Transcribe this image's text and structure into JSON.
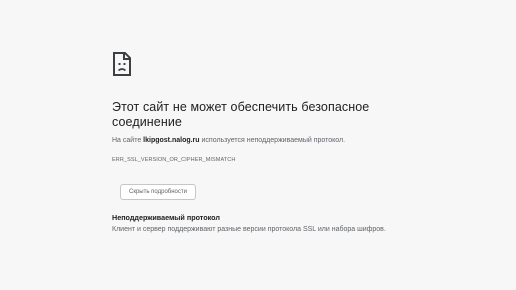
{
  "error": {
    "icon": "sad-page-icon",
    "heading": "Этот сайт не может обеспечить безопасное соединение",
    "summary_prefix": "На сайте ",
    "host": "lkipgost.nalog.ru",
    "summary_suffix": " используется неподдерживаемый протокол.",
    "code": "ERR_SSL_VERSION_OR_CIPHER_MISMATCH",
    "details_button_label": "Скрыть подробности",
    "details_title": "Неподдерживаемый протокол",
    "details_text": "Клиент и сервер поддерживают разные версии протокола SSL или набора шифров."
  },
  "colors": {
    "background": "#f7f7f7",
    "text_primary": "#202124",
    "text_secondary": "#5f6368"
  }
}
